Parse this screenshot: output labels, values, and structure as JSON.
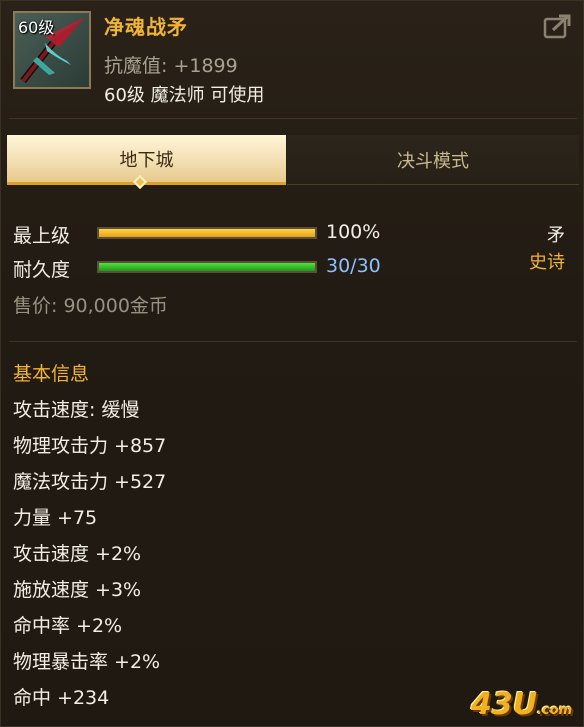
{
  "item": {
    "level_badge": "60级",
    "name": "净魂战矛",
    "stat_line": "抗魔值: +1899",
    "requirement": "60级 魔法师 可使用",
    "type": "矛",
    "rarity": "史诗"
  },
  "tabs": [
    {
      "label": "地下城",
      "active": true
    },
    {
      "label": "决斗模式",
      "active": false
    }
  ],
  "bars": {
    "upgrade": {
      "label": "最上级",
      "value_text": "100%",
      "fraction": 1.0
    },
    "durability": {
      "label": "耐久度",
      "value_text": "30/30",
      "fraction": 1.0
    }
  },
  "price": "售价: 90,000金币",
  "basic_info": {
    "title": "基本信息",
    "attributes": [
      "攻击速度: 缓慢",
      "物理攻击力 +857",
      "魔法攻击力 +527",
      "力量 +75",
      "攻击速度 +2%",
      "施放速度 +3%",
      "命中率 +2%",
      "物理暴击率 +2%",
      "命中 +234"
    ]
  },
  "watermark": {
    "main": "43U",
    "suffix": ".com"
  },
  "colors": {
    "name_gold": "#f0b437",
    "bar_gold": "#e8a010",
    "bar_green": "#1f9a18",
    "durability_text": "#8ec0ff",
    "background": "#221c14"
  },
  "icons": {
    "share": "share-icon",
    "weapon": "spear-icon",
    "tab_marker": "diamond-marker-icon"
  }
}
